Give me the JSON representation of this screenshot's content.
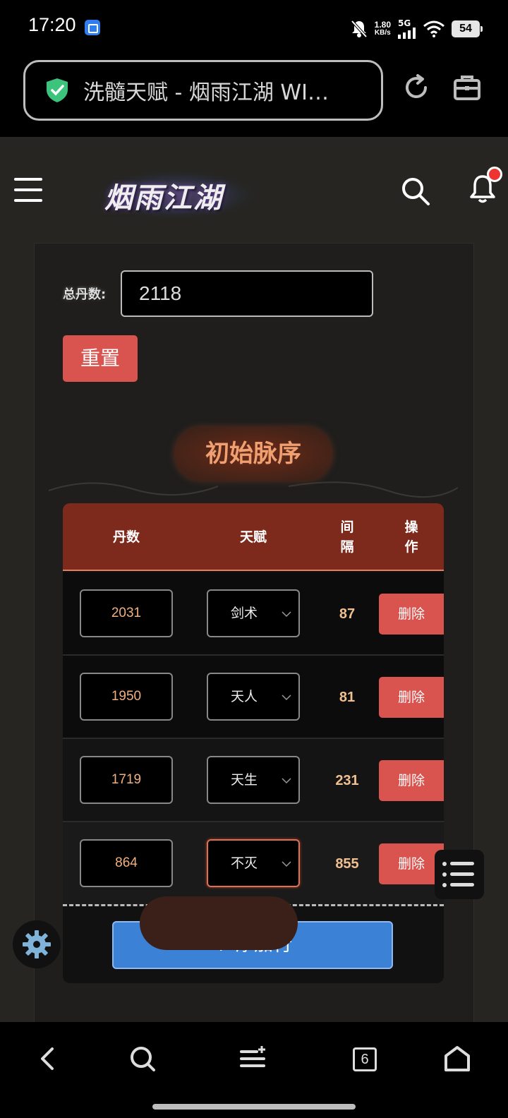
{
  "status": {
    "time": "17:20",
    "speed_value": "1.80",
    "speed_unit": "KB/s",
    "network": "5G",
    "battery": "54"
  },
  "browser": {
    "url_title": "洗髓天赋 - 烟雨江湖 WI…",
    "tab_count": "6"
  },
  "site": {
    "logo_text": "烟雨江湖"
  },
  "form": {
    "total_label": "总丹数:",
    "total_value": "2118",
    "reset_label": "重置"
  },
  "section": {
    "title": "初始脉序"
  },
  "table": {
    "headers": {
      "dan": "丹数",
      "talent": "天赋",
      "gap": "间\n隔",
      "op": "操\n作"
    },
    "rows": [
      {
        "dan": "2031",
        "talent": "剑术",
        "gap": "87",
        "action": "删除"
      },
      {
        "dan": "1950",
        "talent": "天人",
        "gap": "81",
        "action": "删除"
      },
      {
        "dan": "1719",
        "talent": "天生",
        "gap": "231",
        "action": "删除"
      },
      {
        "dan": "864",
        "talent": "不灭",
        "gap": "855",
        "action": "删除"
      }
    ],
    "add_row_label": "+ 添加行"
  },
  "colors": {
    "accent_red": "#d9534f",
    "header_brown": "#7d2a1c",
    "add_blue": "#3b82d6"
  }
}
